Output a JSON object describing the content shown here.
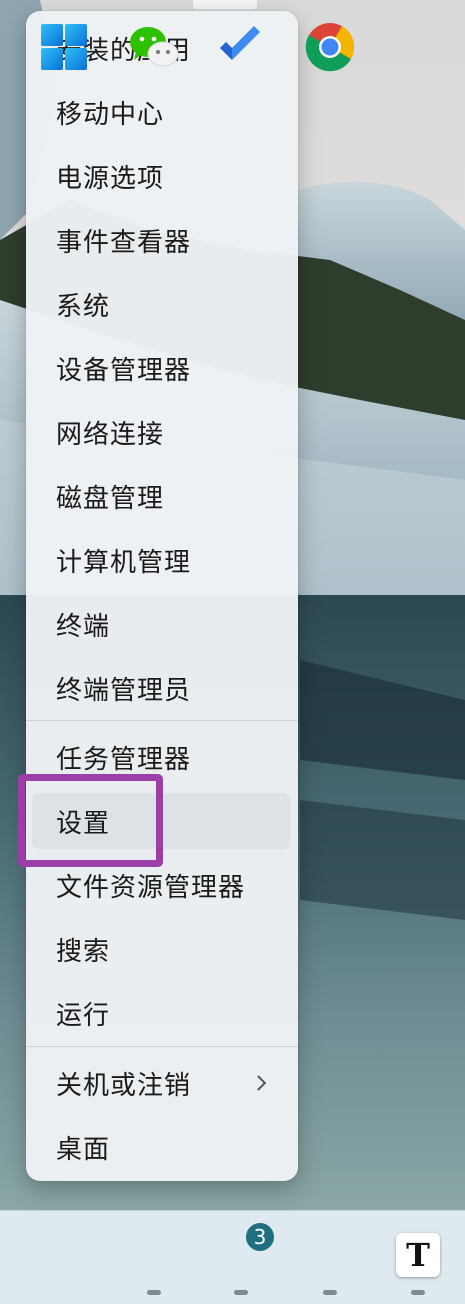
{
  "menu": {
    "items": [
      {
        "label": "安装的应用"
      },
      {
        "label": "移动中心"
      },
      {
        "label": "电源选项"
      },
      {
        "label": "事件查看器"
      },
      {
        "label": "系统"
      },
      {
        "label": "设备管理器"
      },
      {
        "label": "网络连接"
      },
      {
        "label": "磁盘管理"
      },
      {
        "label": "计算机管理"
      },
      {
        "label": "终端"
      },
      {
        "label": "终端管理员"
      },
      {
        "label": "任务管理器"
      },
      {
        "label": "设置"
      },
      {
        "label": "文件资源管理器"
      },
      {
        "label": "搜索"
      },
      {
        "label": "运行"
      },
      {
        "label": "关机或注销"
      },
      {
        "label": "桌面"
      }
    ],
    "highlighted_item": "设置",
    "highlight_color": "#9b3ea7"
  },
  "taskbar": {
    "apps": [
      {
        "icon": "windows-start-icon"
      },
      {
        "icon": "wechat-icon"
      },
      {
        "icon": "todo-icon",
        "badge": "3"
      },
      {
        "icon": "chrome-icon"
      },
      {
        "icon": "typora-icon",
        "glyph": "T"
      }
    ]
  }
}
